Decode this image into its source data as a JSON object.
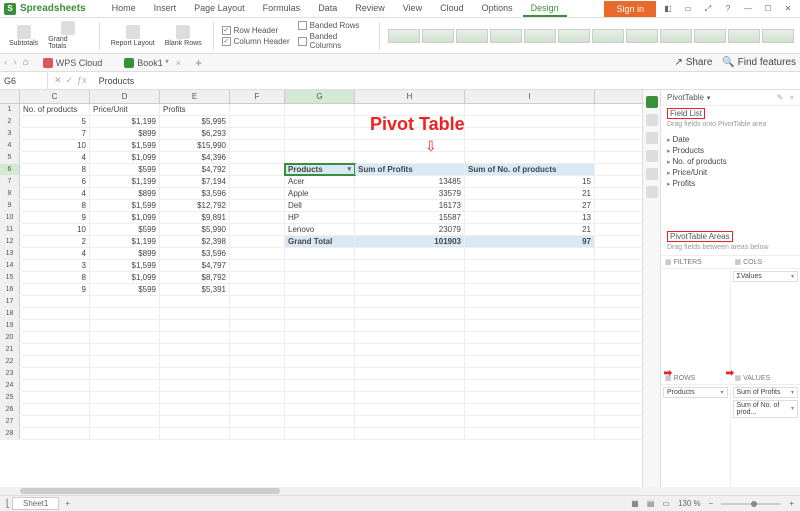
{
  "app": {
    "name": "Spreadsheets",
    "signin": "Sign in"
  },
  "menu_tabs": [
    "Home",
    "Insert",
    "Page Layout",
    "Formulas",
    "Data",
    "Review",
    "View",
    "Cloud",
    "Options",
    "Design"
  ],
  "active_tab_idx": 9,
  "ribbon": {
    "subtotals": "Subtotals",
    "grandtotals": "Grand Totals",
    "reportlayout": "Report Layout",
    "blankrows": "Blank Rows",
    "row_header": "Row Header",
    "col_header": "Column Header",
    "banded_rows": "Banded Rows",
    "banded_cols": "Banded Columns"
  },
  "doc_tabs": {
    "wps": "WPS Cloud",
    "book": "Book1 *"
  },
  "namebox": "G6",
  "formula": "Products",
  "toolbar_right": {
    "share": "Share",
    "find": "Find features"
  },
  "columns": [
    "C",
    "D",
    "E",
    "F",
    "G",
    "H",
    "I"
  ],
  "sheet_headers": {
    "c": "No. of products",
    "d": "Price/Unit",
    "e": "Profits"
  },
  "sheet_rows": [
    {
      "c": "5",
      "d": "$1,199",
      "e": "$5,995"
    },
    {
      "c": "7",
      "d": "$899",
      "e": "$6,293"
    },
    {
      "c": "10",
      "d": "$1,599",
      "e": "$15,990"
    },
    {
      "c": "4",
      "d": "$1,099",
      "e": "$4,396"
    },
    {
      "c": "8",
      "d": "$599",
      "e": "$4,792"
    },
    {
      "c": "6",
      "d": "$1,199",
      "e": "$7,194"
    },
    {
      "c": "4",
      "d": "$899",
      "e": "$3,596"
    },
    {
      "c": "8",
      "d": "$1,599",
      "e": "$12,792"
    },
    {
      "c": "9",
      "d": "$1,099",
      "e": "$9,891"
    },
    {
      "c": "10",
      "d": "$599",
      "e": "$5,990"
    },
    {
      "c": "2",
      "d": "$1,199",
      "e": "$2,398"
    },
    {
      "c": "4",
      "d": "$899",
      "e": "$3,596"
    },
    {
      "c": "3",
      "d": "$1,599",
      "e": "$4,797"
    },
    {
      "c": "8",
      "d": "$1,099",
      "e": "$8,792"
    },
    {
      "c": "9",
      "d": "$599",
      "e": "$5,391"
    }
  ],
  "pivot": {
    "callout": "Pivot Table",
    "headers": {
      "products": "Products",
      "sum_profits": "Sum of Profits",
      "sum_no": "Sum of No. of products"
    },
    "rows": [
      {
        "p": "Acer",
        "sp": "13485",
        "sn": "15"
      },
      {
        "p": "Apple",
        "sp": "33579",
        "sn": "21"
      },
      {
        "p": "Dell",
        "sp": "16173",
        "sn": "27"
      },
      {
        "p": "HP",
        "sp": "15587",
        "sn": "13"
      },
      {
        "p": "Lenovo",
        "sp": "23079",
        "sn": "21"
      }
    ],
    "grand": {
      "label": "Grand Total",
      "sp": "101903",
      "sn": "97"
    }
  },
  "panel": {
    "title": "PivotTable",
    "fieldlist": "Field List",
    "drag_hint": "Drag fields onto PivotTable area",
    "fields": [
      "Date",
      "Products",
      "No. of products",
      "Price/Unit",
      "Profits"
    ],
    "areas_title": "PivotTable Areas",
    "areas_hint": "Drag fields between areas below",
    "filters": "FILTERS",
    "cols": "COLS",
    "rows": "ROWS",
    "values": "VALUES",
    "cols_pill": "ΣValues",
    "rows_pill": "Products",
    "values_pill1": "Sum of Profits",
    "values_pill2": "Sum of No. of prod..."
  },
  "sheet_tab": "Sheet1",
  "zoom": "130 %",
  "chart_data": {
    "type": "table",
    "title": "Pivot Table — Sum of Profits and Sum of No. of products by Products",
    "columns": [
      "Products",
      "Sum of Profits",
      "Sum of No. of products"
    ],
    "rows": [
      [
        "Acer",
        13485,
        15
      ],
      [
        "Apple",
        33579,
        21
      ],
      [
        "Dell",
        16173,
        27
      ],
      [
        "HP",
        15587,
        13
      ],
      [
        "Lenovo",
        23079,
        21
      ]
    ],
    "totals": [
      "Grand Total",
      101903,
      97
    ]
  }
}
